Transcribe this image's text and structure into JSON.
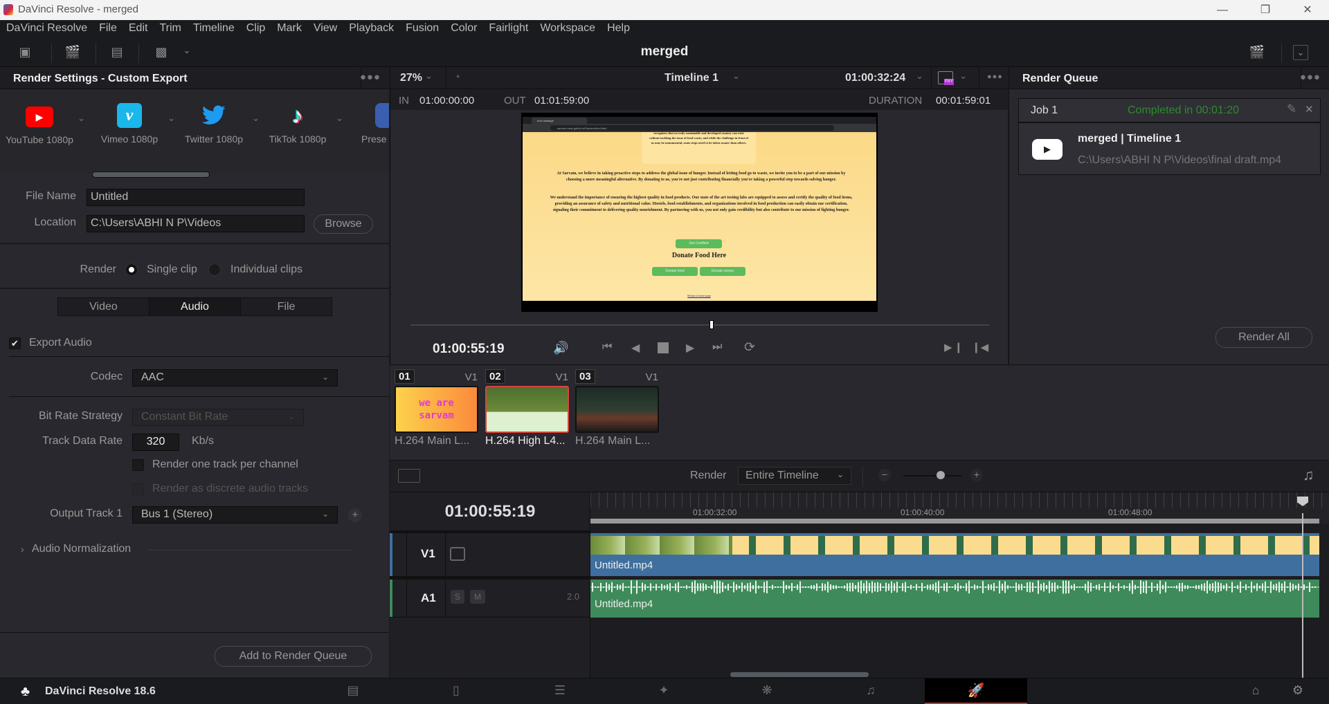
{
  "window": {
    "title": "DaVinci Resolve - merged"
  },
  "menu": [
    "DaVinci Resolve",
    "File",
    "Edit",
    "Trim",
    "Timeline",
    "Clip",
    "Mark",
    "View",
    "Playback",
    "Fusion",
    "Color",
    "Fairlight",
    "Workspace",
    "Help"
  ],
  "toolbar": {
    "project_title": "merged"
  },
  "render_settings": {
    "title": "Render Settings - Custom Export",
    "presets": [
      {
        "label": "YouTube 1080p",
        "icon": "youtube-icon",
        "color": "#ff0000"
      },
      {
        "label": "Vimeo 1080p",
        "icon": "vimeo-icon",
        "color": "#1ab7ea"
      },
      {
        "label": "Twitter 1080p",
        "icon": "twitter-icon",
        "color": "#1d9bf0"
      },
      {
        "label": "TikTok 1080p",
        "icon": "tiktok-icon",
        "color": "#ffffff"
      },
      {
        "label": "Prese",
        "icon": "presentation-icon",
        "color": "#3a5fb0"
      }
    ],
    "file_name_label": "File Name",
    "file_name": "Untitled",
    "location_label": "Location",
    "location": "C:\\Users\\ABHI N P\\Videos",
    "browse": "Browse",
    "render_label": "Render",
    "render_options": [
      {
        "label": "Single clip",
        "selected": true
      },
      {
        "label": "Individual clips",
        "selected": false
      }
    ],
    "tabs": [
      {
        "label": "Video",
        "active": false
      },
      {
        "label": "Audio",
        "active": true
      },
      {
        "label": "File",
        "active": false
      }
    ],
    "export_audio_label": "Export Audio",
    "export_audio_checked": true,
    "codec_label": "Codec",
    "codec": "AAC",
    "bitrate_strategy_label": "Bit Rate Strategy",
    "bitrate_strategy": "Constant Bit Rate",
    "track_data_rate_label": "Track Data Rate",
    "track_data_rate": "320",
    "track_data_rate_unit": "Kb/s",
    "one_track_per_channel": "Render one track per channel",
    "discrete_tracks": "Render as discrete audio tracks",
    "output_track_label": "Output Track 1",
    "output_track": "Bus 1 (Stereo)",
    "audio_normalization": "Audio Normalization",
    "add_to_queue": "Add to Render Queue"
  },
  "viewer": {
    "zoom": "27%",
    "timeline_name": "Timeline 1",
    "timecode": "01:00:32:24",
    "in_label": "IN",
    "in": "01:00:00:00",
    "out_label": "OUT",
    "out": "01:01:59:00",
    "duration_label": "DURATION",
    "duration": "00:01:59:01",
    "current_timecode": "01:00:55:19",
    "scrub_position": 0.52,
    "preview": {
      "tab_title": "food wastage",
      "url": "sarvam.osac.github.io/Sarvam/food.html",
      "para1": "recognizes that no truly sustainable and developed country can exist without tackling the issue of food waste, and while the challenge in front of us may be monumental, some steps need to be taken sooner than others.",
      "para2": "At Sarvam, we believe in taking proactive steps to address the global issue of hunger. Instead of letting food go to waste, we invite you to be a part of our mission by choosing a more meaningful alternative. By donating to us, you're not just contributing financially you're taking a powerful step towards solving hunger.",
      "para3": "We understand the importance of ensuring the highest quality in food products. Our state of the art testing labs are equipped to assess and certify the quality of food items, providing an assurance of safety and nutritional value. Hostels, food establishments, and organizations involved in food production can easily obtain our certification, signaling their commitment to delivering quality nourishment. By partnering with us, you not only gain credibility but also contribute to our mission of fighting hunger.",
      "certified_btn": "Get Certified",
      "donate_heading": "Donate Food Here",
      "donate_food": "Donate food",
      "donate_money": "Donate money",
      "return_link": "Return to home page"
    }
  },
  "render_queue": {
    "title": "Render Queue",
    "jobs": [
      {
        "name": "Job 1",
        "status": "Completed in 00:01:20",
        "title": "merged | Timeline 1",
        "path": "C:\\Users\\ABHI N P\\Videos\\final draft.mp4"
      }
    ],
    "render_all": "Render All"
  },
  "clips": [
    {
      "num": "01",
      "track": "V1",
      "caption": "H.264 Main L...",
      "selected": false
    },
    {
      "num": "02",
      "track": "V1",
      "caption": "H.264 High L4...",
      "selected": true
    },
    {
      "num": "03",
      "track": "V1",
      "caption": "H.264 Main L...",
      "selected": false
    }
  ],
  "timeline": {
    "render_label": "Render",
    "render_range": "Entire Timeline",
    "timecode": "01:00:55:19",
    "ruler_labels": [
      "01:00:32:00",
      "01:00:40:00",
      "01:00:48:00"
    ],
    "zoom_level": 0.5,
    "tracks": [
      {
        "name": "V1",
        "clip": "Untitled.mp4",
        "color": "#3f6f9e"
      },
      {
        "name": "A1",
        "clip": "Untitled.mp4",
        "color": "#3f8a5a",
        "solo": "S",
        "mute": "M",
        "level": "2.0"
      }
    ]
  },
  "footer": {
    "app_version": "DaVinci Resolve 18.6",
    "pages": [
      "media",
      "cut",
      "edit",
      "fusion",
      "color",
      "fairlight",
      "deliver"
    ],
    "active_page": "deliver"
  }
}
